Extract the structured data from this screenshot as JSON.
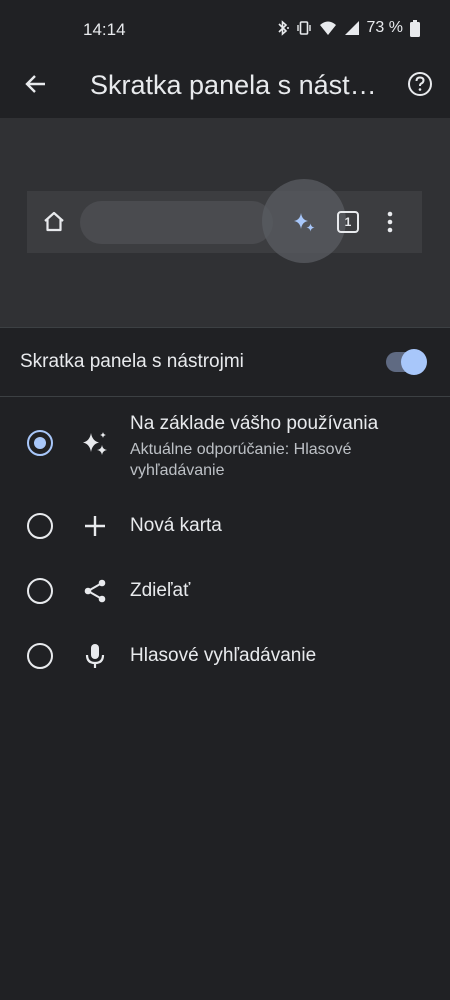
{
  "status_bar": {
    "time": "14:14",
    "battery": "73 %",
    "icons": [
      "bluetooth-icon",
      "vibrate-icon",
      "wifi-icon",
      "signal-icon",
      "battery-icon"
    ]
  },
  "app_bar": {
    "title": "Skratka panela s nástrojmi",
    "back_icon": "arrow-back-icon",
    "help_icon": "help-icon"
  },
  "preview": {
    "tab_count": "1",
    "icons": [
      "home-icon",
      "sparkle-icon",
      "tab-switcher-icon",
      "more-vert-icon"
    ],
    "accent": "#a8c7fa"
  },
  "toggle": {
    "label": "Skratka panela s nástrojmi",
    "on": true
  },
  "options": [
    {
      "title": "Na základe vášho používania",
      "subtitle": "Aktuálne odporúčanie: Hlasové vyhľadávanie",
      "icon": "sparkle-icon",
      "selected": true
    },
    {
      "title": "Nová karta",
      "icon": "plus-icon",
      "selected": false
    },
    {
      "title": "Zdieľať",
      "icon": "share-icon",
      "selected": false
    },
    {
      "title": "Hlasové vyhľadávanie",
      "icon": "mic-icon",
      "selected": false
    }
  ],
  "colors": {
    "background": "#202124",
    "preview_bg": "#303134",
    "accent": "#a8c7fa",
    "text": "#e8eaed"
  }
}
